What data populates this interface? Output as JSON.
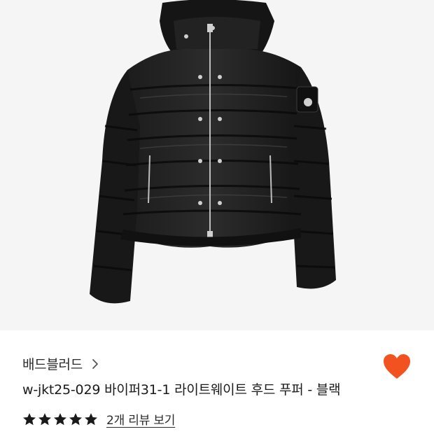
{
  "product_image": {
    "alt": "black hooded lightweight puffer jacket"
  },
  "brand": {
    "name": "배드블러드",
    "chevron_icon": "chevron-right-icon"
  },
  "product": {
    "title": "w-jkt25-029 바이퍼31-1 라이트웨이트 후드 푸퍼 - 블랙"
  },
  "wishlist": {
    "icon": "heart-icon",
    "color": "#f2521f"
  },
  "rating": {
    "stars": 5,
    "max_stars": 5,
    "star_icon": "star-icon",
    "review_link_label": "2개 리뷰 보기"
  },
  "colors": {
    "background": "#ffffff",
    "image_background": "#f5f5f5",
    "accent": "#f2521f",
    "text": "#1a1a1a"
  }
}
